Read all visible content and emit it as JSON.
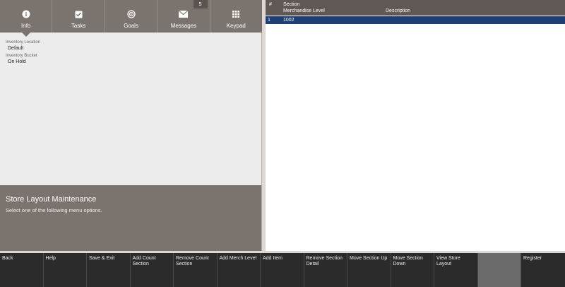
{
  "tabs": [
    {
      "label": "Info",
      "icon": "info-icon",
      "active": true
    },
    {
      "label": "Tasks",
      "icon": "tasks-icon"
    },
    {
      "label": "Goals",
      "icon": "goals-icon"
    },
    {
      "label": "Messages",
      "icon": "mail-icon",
      "badge": "5"
    },
    {
      "label": "Keypad",
      "icon": "keypad-icon"
    }
  ],
  "info": {
    "location_label": "Inventory Location",
    "location_value": "Default",
    "bucket_label": "Inventory Bucket",
    "bucket_value": "On Hold"
  },
  "instructions": {
    "title": "Store Layout Maintenance",
    "message": "Select one of the following menu options."
  },
  "grid": {
    "headers": {
      "num": "#",
      "section": "Section",
      "merch_level": "Merchandise Level",
      "description": "Description"
    },
    "rows": [
      {
        "num": "1",
        "merch_level": "1002",
        "description": ""
      }
    ]
  },
  "function_keys": [
    {
      "label": "Back"
    },
    {
      "label": "Help"
    },
    {
      "label": "Save & Exit"
    },
    {
      "label": "Add Count Section"
    },
    {
      "label": "Remove Count Section"
    },
    {
      "label": "Add Merch Level"
    },
    {
      "label": "Add Item"
    },
    {
      "label": "Remove Section Detail"
    },
    {
      "label": "Move Section Up"
    },
    {
      "label": "Move Section Down"
    },
    {
      "label": "View Store Layout"
    },
    {
      "label": "",
      "disabled": true
    },
    {
      "label": "Register"
    }
  ],
  "colors": {
    "tab_bar": "#7b736e",
    "selected_row": "#1f3f73",
    "grid_header": "#5f5854"
  }
}
